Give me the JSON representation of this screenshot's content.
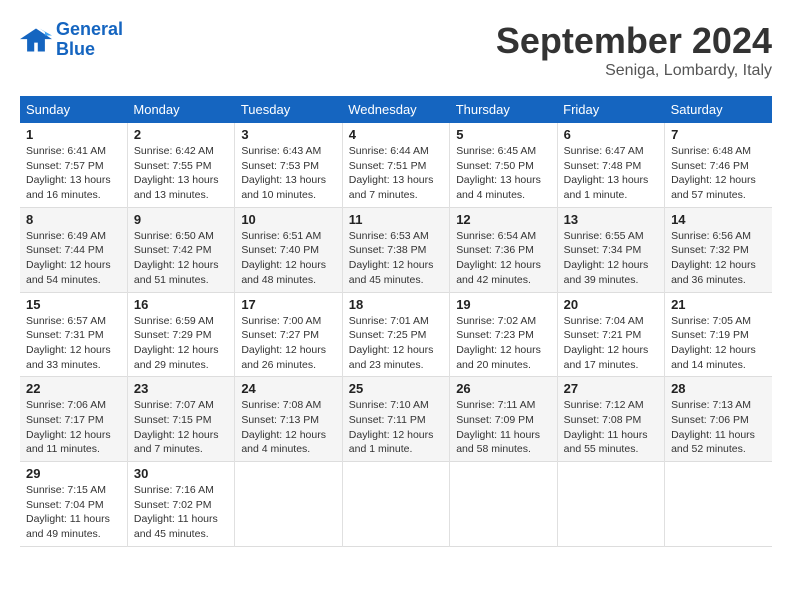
{
  "header": {
    "logo_line1": "General",
    "logo_line2": "Blue",
    "month": "September 2024",
    "location": "Seniga, Lombardy, Italy"
  },
  "days_of_week": [
    "Sunday",
    "Monday",
    "Tuesday",
    "Wednesday",
    "Thursday",
    "Friday",
    "Saturday"
  ],
  "weeks": [
    [
      {
        "day": "1",
        "sunrise": "Sunrise: 6:41 AM",
        "sunset": "Sunset: 7:57 PM",
        "daylight": "Daylight: 13 hours and 16 minutes."
      },
      {
        "day": "2",
        "sunrise": "Sunrise: 6:42 AM",
        "sunset": "Sunset: 7:55 PM",
        "daylight": "Daylight: 13 hours and 13 minutes."
      },
      {
        "day": "3",
        "sunrise": "Sunrise: 6:43 AM",
        "sunset": "Sunset: 7:53 PM",
        "daylight": "Daylight: 13 hours and 10 minutes."
      },
      {
        "day": "4",
        "sunrise": "Sunrise: 6:44 AM",
        "sunset": "Sunset: 7:51 PM",
        "daylight": "Daylight: 13 hours and 7 minutes."
      },
      {
        "day": "5",
        "sunrise": "Sunrise: 6:45 AM",
        "sunset": "Sunset: 7:50 PM",
        "daylight": "Daylight: 13 hours and 4 minutes."
      },
      {
        "day": "6",
        "sunrise": "Sunrise: 6:47 AM",
        "sunset": "Sunset: 7:48 PM",
        "daylight": "Daylight: 13 hours and 1 minute."
      },
      {
        "day": "7",
        "sunrise": "Sunrise: 6:48 AM",
        "sunset": "Sunset: 7:46 PM",
        "daylight": "Daylight: 12 hours and 57 minutes."
      }
    ],
    [
      {
        "day": "8",
        "sunrise": "Sunrise: 6:49 AM",
        "sunset": "Sunset: 7:44 PM",
        "daylight": "Daylight: 12 hours and 54 minutes."
      },
      {
        "day": "9",
        "sunrise": "Sunrise: 6:50 AM",
        "sunset": "Sunset: 7:42 PM",
        "daylight": "Daylight: 12 hours and 51 minutes."
      },
      {
        "day": "10",
        "sunrise": "Sunrise: 6:51 AM",
        "sunset": "Sunset: 7:40 PM",
        "daylight": "Daylight: 12 hours and 48 minutes."
      },
      {
        "day": "11",
        "sunrise": "Sunrise: 6:53 AM",
        "sunset": "Sunset: 7:38 PM",
        "daylight": "Daylight: 12 hours and 45 minutes."
      },
      {
        "day": "12",
        "sunrise": "Sunrise: 6:54 AM",
        "sunset": "Sunset: 7:36 PM",
        "daylight": "Daylight: 12 hours and 42 minutes."
      },
      {
        "day": "13",
        "sunrise": "Sunrise: 6:55 AM",
        "sunset": "Sunset: 7:34 PM",
        "daylight": "Daylight: 12 hours and 39 minutes."
      },
      {
        "day": "14",
        "sunrise": "Sunrise: 6:56 AM",
        "sunset": "Sunset: 7:32 PM",
        "daylight": "Daylight: 12 hours and 36 minutes."
      }
    ],
    [
      {
        "day": "15",
        "sunrise": "Sunrise: 6:57 AM",
        "sunset": "Sunset: 7:31 PM",
        "daylight": "Daylight: 12 hours and 33 minutes."
      },
      {
        "day": "16",
        "sunrise": "Sunrise: 6:59 AM",
        "sunset": "Sunset: 7:29 PM",
        "daylight": "Daylight: 12 hours and 29 minutes."
      },
      {
        "day": "17",
        "sunrise": "Sunrise: 7:00 AM",
        "sunset": "Sunset: 7:27 PM",
        "daylight": "Daylight: 12 hours and 26 minutes."
      },
      {
        "day": "18",
        "sunrise": "Sunrise: 7:01 AM",
        "sunset": "Sunset: 7:25 PM",
        "daylight": "Daylight: 12 hours and 23 minutes."
      },
      {
        "day": "19",
        "sunrise": "Sunrise: 7:02 AM",
        "sunset": "Sunset: 7:23 PM",
        "daylight": "Daylight: 12 hours and 20 minutes."
      },
      {
        "day": "20",
        "sunrise": "Sunrise: 7:04 AM",
        "sunset": "Sunset: 7:21 PM",
        "daylight": "Daylight: 12 hours and 17 minutes."
      },
      {
        "day": "21",
        "sunrise": "Sunrise: 7:05 AM",
        "sunset": "Sunset: 7:19 PM",
        "daylight": "Daylight: 12 hours and 14 minutes."
      }
    ],
    [
      {
        "day": "22",
        "sunrise": "Sunrise: 7:06 AM",
        "sunset": "Sunset: 7:17 PM",
        "daylight": "Daylight: 12 hours and 11 minutes."
      },
      {
        "day": "23",
        "sunrise": "Sunrise: 7:07 AM",
        "sunset": "Sunset: 7:15 PM",
        "daylight": "Daylight: 12 hours and 7 minutes."
      },
      {
        "day": "24",
        "sunrise": "Sunrise: 7:08 AM",
        "sunset": "Sunset: 7:13 PM",
        "daylight": "Daylight: 12 hours and 4 minutes."
      },
      {
        "day": "25",
        "sunrise": "Sunrise: 7:10 AM",
        "sunset": "Sunset: 7:11 PM",
        "daylight": "Daylight: 12 hours and 1 minute."
      },
      {
        "day": "26",
        "sunrise": "Sunrise: 7:11 AM",
        "sunset": "Sunset: 7:09 PM",
        "daylight": "Daylight: 11 hours and 58 minutes."
      },
      {
        "day": "27",
        "sunrise": "Sunrise: 7:12 AM",
        "sunset": "Sunset: 7:08 PM",
        "daylight": "Daylight: 11 hours and 55 minutes."
      },
      {
        "day": "28",
        "sunrise": "Sunrise: 7:13 AM",
        "sunset": "Sunset: 7:06 PM",
        "daylight": "Daylight: 11 hours and 52 minutes."
      }
    ],
    [
      {
        "day": "29",
        "sunrise": "Sunrise: 7:15 AM",
        "sunset": "Sunset: 7:04 PM",
        "daylight": "Daylight: 11 hours and 49 minutes."
      },
      {
        "day": "30",
        "sunrise": "Sunrise: 7:16 AM",
        "sunset": "Sunset: 7:02 PM",
        "daylight": "Daylight: 11 hours and 45 minutes."
      },
      null,
      null,
      null,
      null,
      null
    ]
  ]
}
